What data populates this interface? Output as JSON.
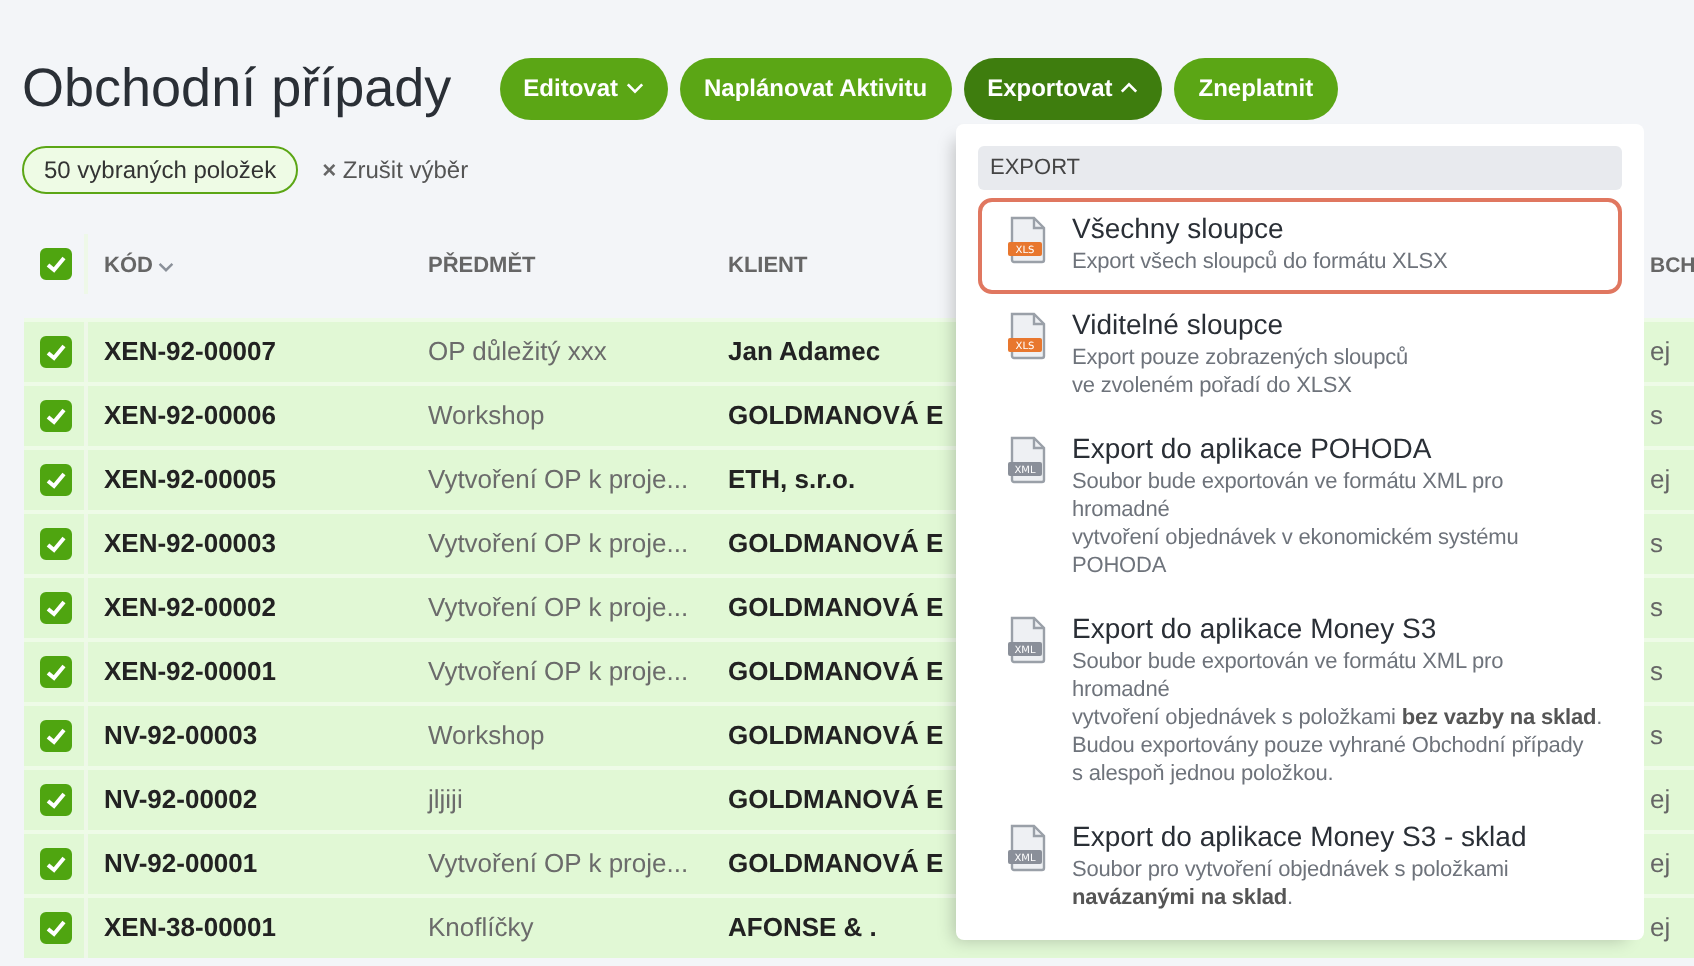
{
  "title": "Obchodní případy",
  "buttons": [
    {
      "label": "Editovat",
      "dropdown": true,
      "expanded": false
    },
    {
      "label": "Naplánovat Aktivitu",
      "dropdown": false,
      "expanded": false
    },
    {
      "label": "Exportovat",
      "dropdown": true,
      "expanded": true
    },
    {
      "label": "Zneplatnit",
      "dropdown": false,
      "expanded": false
    }
  ],
  "selection_chip": "50 vybraných položek",
  "clear_selection": {
    "icon": "×",
    "label": "Zrušit výběr"
  },
  "table": {
    "all_checked": true,
    "columns": [
      {
        "label": "KÓD",
        "sorted": true
      },
      {
        "label": "PŘEDMĚT"
      },
      {
        "label": "KLIENT"
      },
      {
        "label": "BCH"
      }
    ],
    "rows": [
      {
        "checked": true,
        "code": "XEN-92-00007",
        "subject": "OP důležitý xxx",
        "client": "Jan Adamec",
        "column_4": "ej"
      },
      {
        "checked": true,
        "code": "XEN-92-00006",
        "subject": "Workshop",
        "client": "GOLDMANOVÁ E",
        "column_4": "s"
      },
      {
        "checked": true,
        "code": "XEN-92-00005",
        "subject": "Vytvoření OP k proje...",
        "client": "ETH, s.r.o.",
        "column_4": "ej"
      },
      {
        "checked": true,
        "code": "XEN-92-00003",
        "subject": "Vytvoření OP k proje...",
        "client": "GOLDMANOVÁ E",
        "column_4": "s"
      },
      {
        "checked": true,
        "code": "XEN-92-00002",
        "subject": "Vytvoření OP k proje...",
        "client": "GOLDMANOVÁ E",
        "column_4": "s"
      },
      {
        "checked": true,
        "code": "XEN-92-00001",
        "subject": "Vytvoření OP k proje...",
        "client": "GOLDMANOVÁ E",
        "column_4": "s"
      },
      {
        "checked": true,
        "code": "NV-92-00003",
        "subject": "Workshop",
        "client": "GOLDMANOVÁ E",
        "column_4": "s"
      },
      {
        "checked": true,
        "code": "NV-92-00002",
        "subject": "jljiji",
        "client": "GOLDMANOVÁ E",
        "column_4": "ej"
      },
      {
        "checked": true,
        "code": "NV-92-00001",
        "subject": "Vytvoření OP k proje...",
        "client": "GOLDMANOVÁ E",
        "column_4": "ej"
      },
      {
        "checked": true,
        "code": "XEN-38-00001",
        "subject": "Knoflíčky",
        "client": "AFONSE & .",
        "column_4": "ej"
      }
    ]
  },
  "export_menu": {
    "header": "EXPORT",
    "items": [
      {
        "title": "Všechny sloupce",
        "color": "#e8772e",
        "icon_text": "XLS",
        "highlighted": true,
        "lines": [
          "Export všech sloupců do formátu XLSX"
        ]
      },
      {
        "title": "Viditelné sloupce",
        "color": "#e8772e",
        "icon_text": "XLS",
        "highlighted": false,
        "lines": [
          "Export pouze zobrazených sloupců",
          "ve zvoleném pořadí do XLSX"
        ]
      },
      {
        "title": "Export do aplikace POHODA",
        "color": "#8a8f99",
        "icon_text": "XML",
        "highlighted": false,
        "lines": [
          "Soubor bude exportován ve formátu XML pro",
          "hromadné",
          "vytvoření objednávek v ekonomickém systému",
          "POHODA"
        ]
      },
      {
        "title": "Export do aplikace Money S3",
        "color": "#8a8f99",
        "icon_text": "XML",
        "highlighted": false,
        "lines": [
          "Soubor bude exportován ve formátu XML pro",
          "hromadné",
          "vytvoření objednávek s položkami **bez vazby na sklad**.",
          "Budou exportovány pouze vyhrané Obchodní případy",
          "s alespoň jednou položkou."
        ]
      },
      {
        "title": "Export do aplikace Money S3 - sklad",
        "color": "#8a8f99",
        "icon_text": "XML",
        "highlighted": false,
        "lines": [
          "Soubor pro vytvoření objednávek s položkami",
          "**navázanými na sklad**."
        ]
      }
    ]
  }
}
